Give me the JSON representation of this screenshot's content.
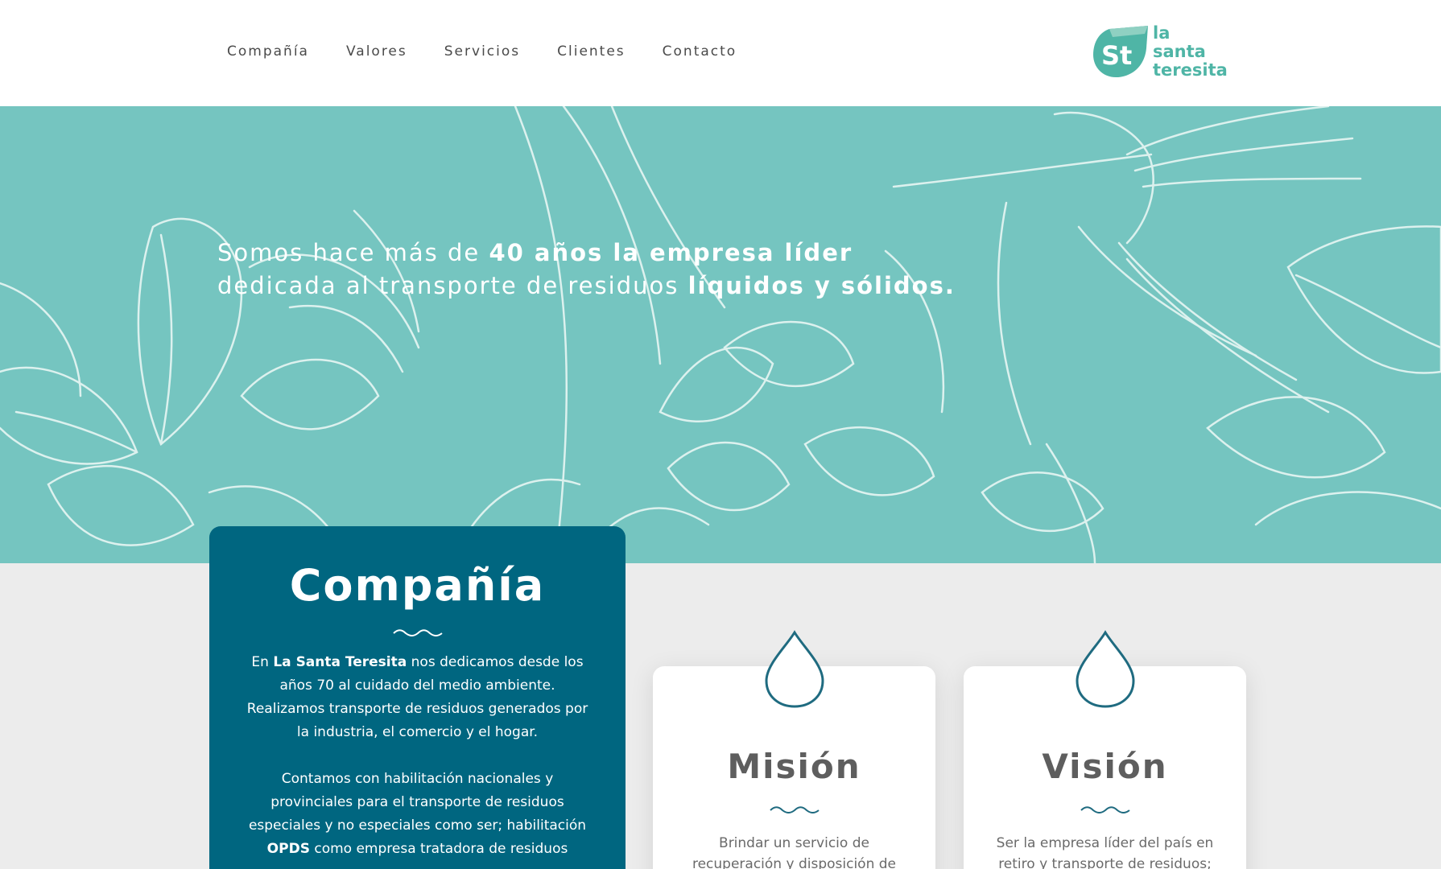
{
  "nav": {
    "items": [
      "Compañía",
      "Valores",
      "Servicios",
      "Clientes",
      "Contacto"
    ]
  },
  "logo": {
    "line1": "la",
    "line2": "santa",
    "line3": "teresita",
    "mark": "St"
  },
  "hero": {
    "line1_normal": "Somos hace más de ",
    "line1_bold": "40 años la empresa líder",
    "line2_normal": "dedicada al transporte de residuos ",
    "line2_bold": "líquidos y sólidos."
  },
  "company": {
    "title": "Compañía",
    "p1_before": "En ",
    "p1_bold": "La Santa Teresita",
    "p1_after": " nos dedicamos desde los años 70 al cuidado del medio ambiente. Realizamos transporte de residuos generados por la industria, el comercio y el hogar.",
    "p2_before": "Contamos con habilitación nacionales y provinciales para el transporte de residuos especiales y no especiales como ser; habilitación ",
    "p2_bold": "OPDS",
    "p2_after": " como empresa tratadora de residuos"
  },
  "mision": {
    "title": "Misión",
    "text": "Brindar un servicio de recuperación y disposición de"
  },
  "vision": {
    "title": "Visión",
    "text": "Ser la empresa líder del país en retiro y transporte de residuos;"
  },
  "colors": {
    "teal": "#75c5c0",
    "dark_teal": "#006680",
    "logo_green": "#4fb5a6",
    "drop_stroke": "#1f6b80"
  },
  "icons": [
    "drop-icon",
    "wave-divider"
  ]
}
